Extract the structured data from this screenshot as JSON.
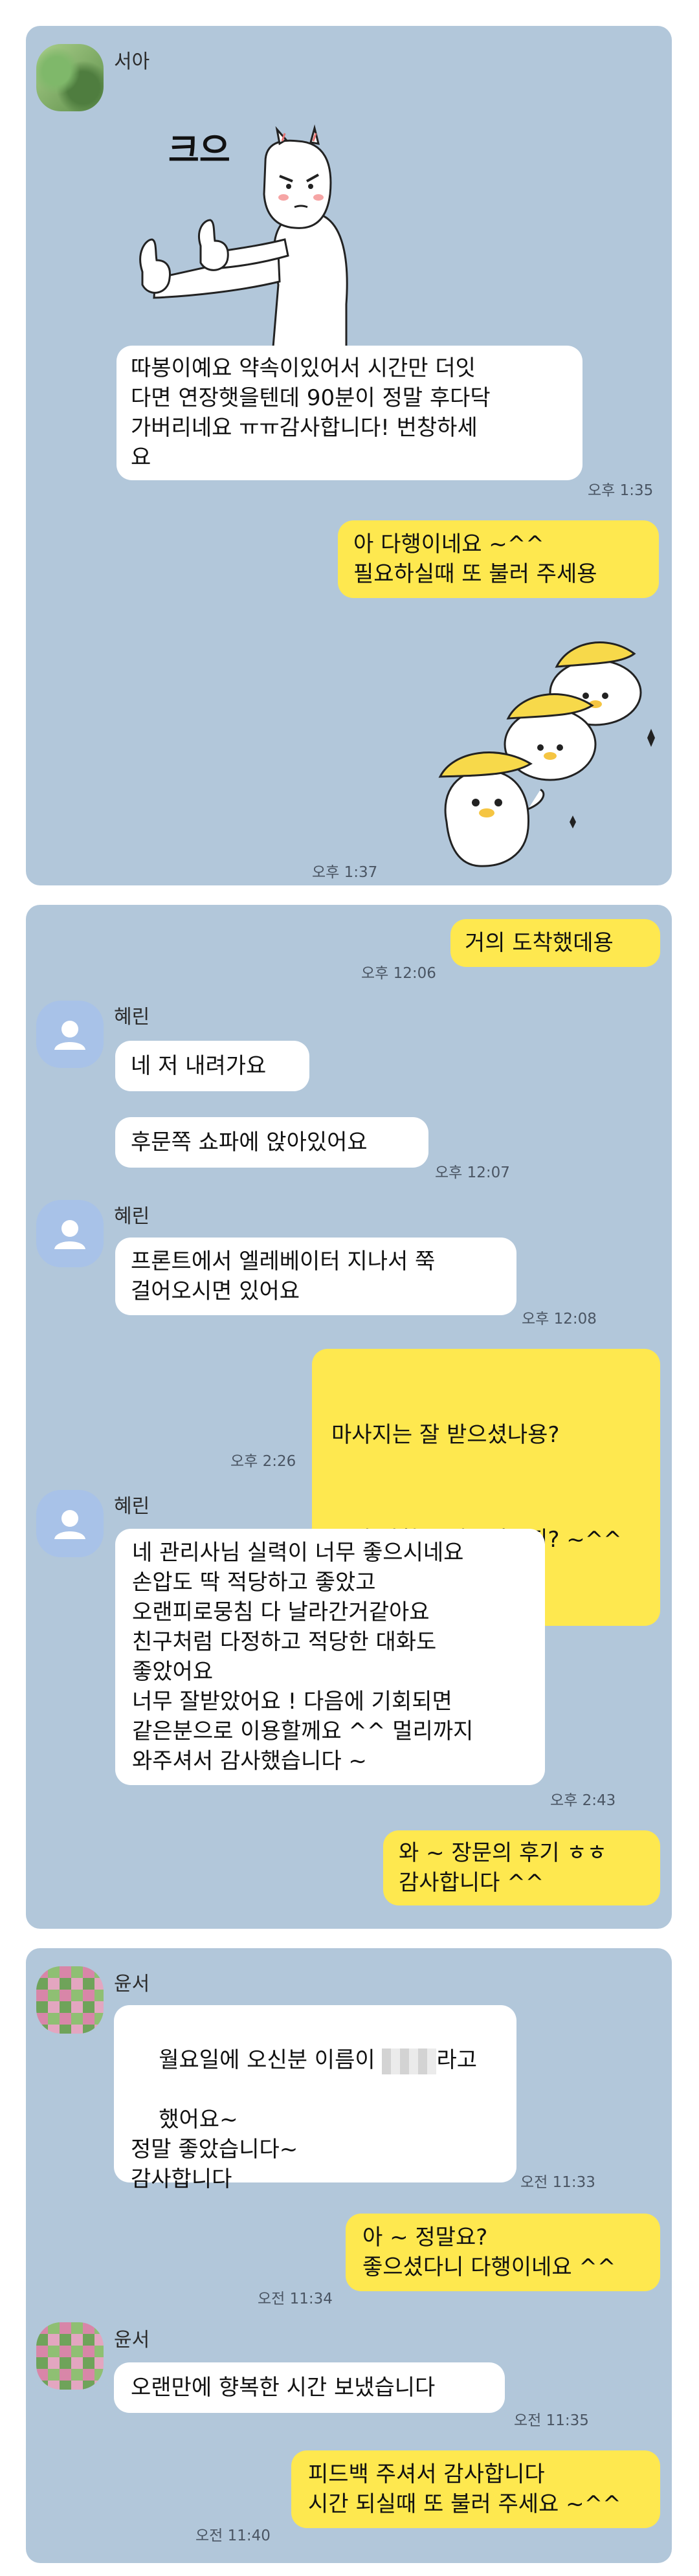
{
  "chat1": {
    "sender": "서아",
    "sticker_text": "크으",
    "incoming": "따봉이예요 약속이있어서 시간만 더잇\n다면 연장햇을텐데 90분이 정말 후다닥\n가버리네요 ㅠㅠ감사합니다! 번창하세\n요",
    "incoming_time": "오후 1:35",
    "outgoing": "아 다행이네요 ~^^\n필요하실때 또 불러 주세용",
    "sticker_time": "오후 1:37"
  },
  "chat2": {
    "out1": "거의 도착했데용",
    "out1_time": "오후 12:06",
    "sender1": "혜린",
    "in1a": "네 저 내려가요",
    "in1b": "후문쪽 쇼파에 앉아있어요",
    "in1_time": "오후 12:07",
    "sender2": "혜린",
    "in2": "프론트에서 엘레베이터 지나서 쭉\n걸어오시면 있어요",
    "in2_time": "오후 12:08",
    "out2a": "마사지는 잘 받으셨나용?",
    "out2b": "불만 사항은 없으셨는지? ~^^",
    "out2_time": "오후 2:26",
    "sender3": "혜린",
    "in3": "네 관리사님 실력이 너무 좋으시네요\n손압도 딱 적당하고 좋았고\n오랜피로뭉침 다 날라간거같아요\n친구처럼 다정하고 적당한 대화도\n좋았어요\n너무 잘받았어요 ! 다음에 기회되면\n같은분으로 이용할께요 ^^ 멀리까지\n와주셔서 감사했습니다 ~",
    "in3_time": "오후 2:43",
    "out3": "와 ~ 장문의 후기 ㅎㅎ\n감사합니다 ^^"
  },
  "chat3": {
    "sender1": "윤서",
    "in1_pre": "월요일에 오신분 이름이 ",
    "in1_post": "라고",
    "in1_rest": "했어요~\n정말 좋았습니다~\n감사합니다",
    "in1_time": "오전 11:33",
    "out1": "아 ~ 정말요?\n좋으셨다니 다행이네요 ^^",
    "out1_time": "오전 11:34",
    "sender2": "윤서",
    "in2": "오랜만에 향복한 시간 보냈습니다",
    "in2_time": "오전 11:35",
    "out2": "피드백 주셔서 감사합니다\n시간 되실때 또 불러 주세요 ~^^",
    "out2_time": "오전 11:40"
  },
  "colors": {
    "panel": "#b2c7da",
    "outgoing": "#fee84f",
    "incoming": "#ffffff",
    "default_avatar": "#a8c2e8"
  },
  "icons": [
    "default-person-icon",
    "thumbs-up-sticker",
    "banana-bunny-sticker"
  ]
}
